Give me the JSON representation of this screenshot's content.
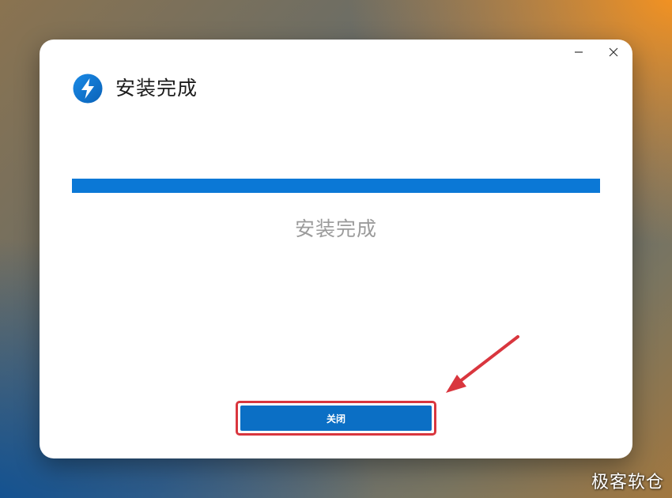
{
  "window": {
    "title": "安装完成",
    "minimize_icon": "minimize-icon",
    "close_icon": "close-icon"
  },
  "app_icon": {
    "name": "lightning-bolt-icon",
    "color": "#0b78d6"
  },
  "progress": {
    "percent": 100,
    "fill_color": "#0b78d6"
  },
  "status": {
    "text": "安装完成"
  },
  "actions": {
    "close_label": "关闭",
    "button_color": "#0b6fc5",
    "highlight_color": "#d9363e"
  },
  "annotation": {
    "arrow_icon": "red-arrow-icon",
    "color": "#d9363e"
  },
  "watermark": {
    "text": "极客软仓"
  }
}
